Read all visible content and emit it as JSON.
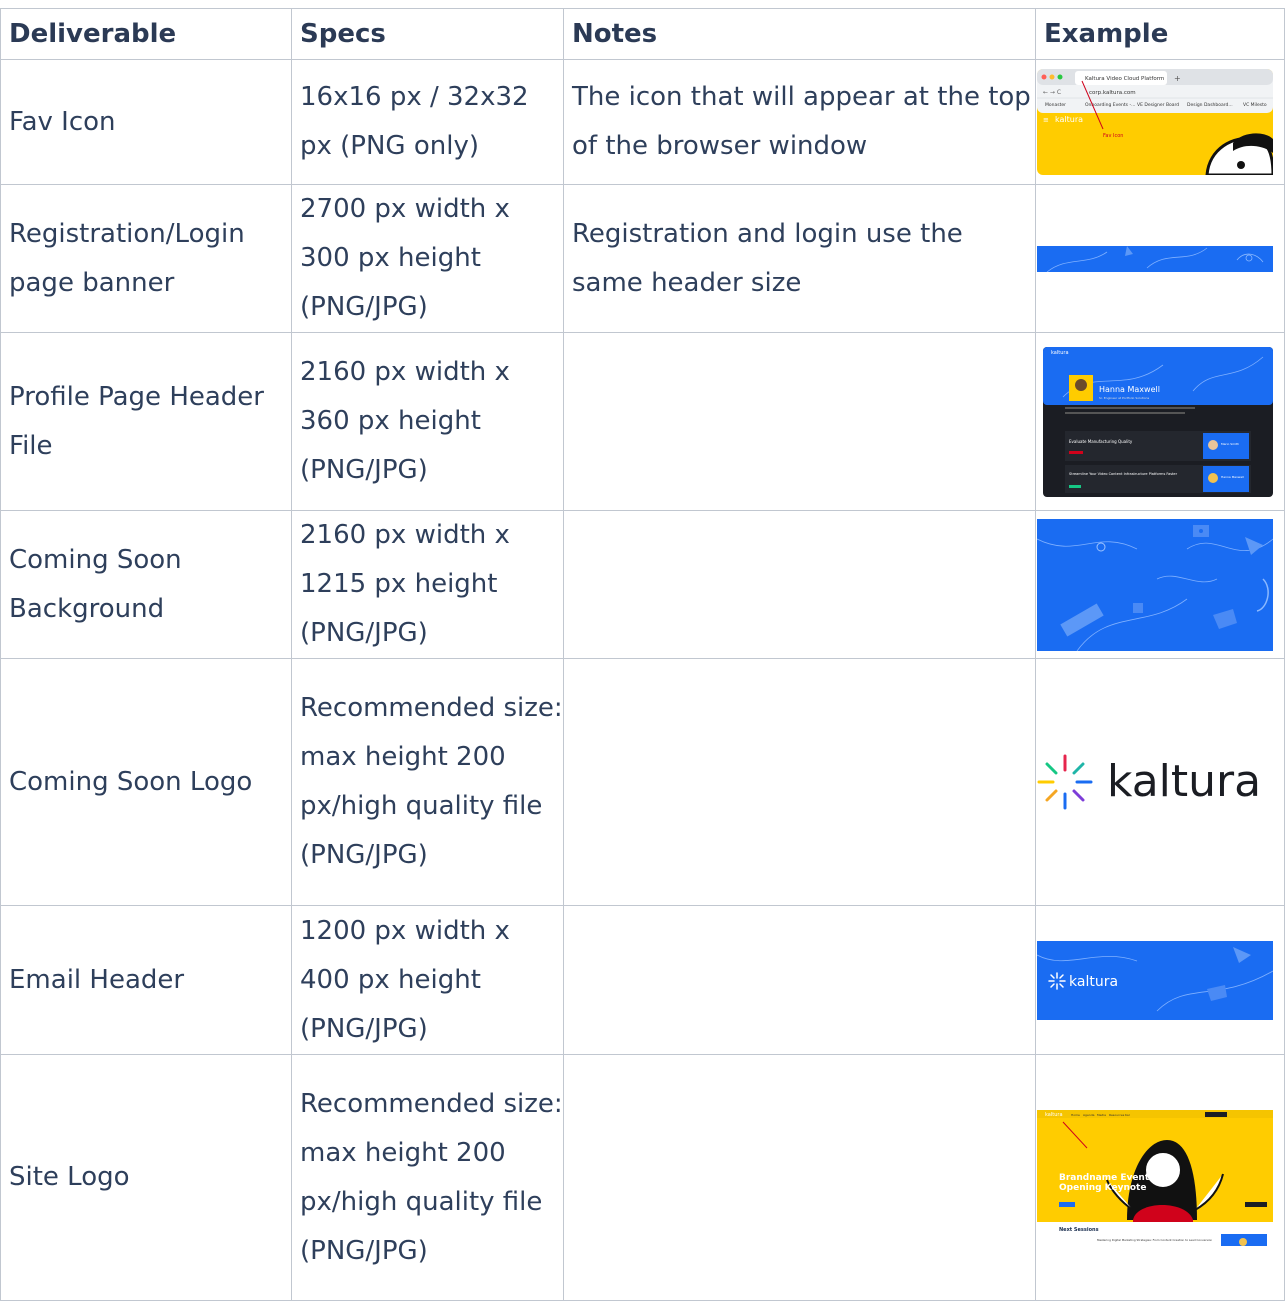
{
  "headers": [
    "Deliverable",
    "Specs",
    "Notes",
    "Example"
  ],
  "rows": [
    {
      "deliverable": "Fav Icon",
      "specs": "16x16 px / 32x32 px (PNG only)",
      "notes": "The icon that will appear at the top of the browser window",
      "example": "fav-icon-screenshot"
    },
    {
      "deliverable": "Registration/Login page banner",
      "specs": "2700 px width x 300 px height (PNG/JPG)",
      "notes": "Registration and login use the same header size",
      "example": "banner-strip"
    },
    {
      "deliverable": "Profile Page Header File",
      "specs": "2160 px width x 360 px height (PNG/JPG)",
      "notes": "",
      "example": "profile-page-screenshot"
    },
    {
      "deliverable": "Coming Soon Background",
      "specs": "2160 px width x 1215 px height (PNG/JPG)",
      "notes": "",
      "example": "blue-background"
    },
    {
      "deliverable": "Coming Soon Logo",
      "specs": "Recommended size: max height 200 px/high quality file (PNG/JPG)",
      "notes": "",
      "example": "kaltura-logo"
    },
    {
      "deliverable": "Email Header",
      "specs": "1200 px width x 400 px height (PNG/JPG)",
      "notes": "",
      "example": "email-header"
    },
    {
      "deliverable": "Site Logo",
      "specs": "Recommended size: max height 200 px/high quality file (PNG/JPG)",
      "notes": "",
      "example": "site-logo-screenshot"
    }
  ],
  "examples": {
    "fav_icon": {
      "tab_title": "Kaltura Video Cloud Platform",
      "url": "corp.kaltura.com",
      "bookmarks": [
        "Monaster",
        "Onboarding Events -...",
        "VE Designer Board",
        "Design Dashboard...",
        "VC Milesto"
      ],
      "brand": "kaltura",
      "annotation": "Fav Icon"
    },
    "profile": {
      "brand": "kaltura",
      "name": "Hanna Maxwell",
      "subtitle": "Sr. Engineer at Portfolio Solutions",
      "session1_title": "Evaluate Manufacturing Quality",
      "session2_title": "Streamline Your Video Content Infrastructure Platforms Faster",
      "speaker1": "Mario Smith",
      "speaker2": "Hanna Maxwell"
    },
    "logo": {
      "wordmark": "kaltura"
    },
    "email": {
      "wordmark": "kaltura"
    },
    "site": {
      "brand": "kaltura",
      "nav": [
        "Home",
        "Agenda",
        "Media",
        "Resources",
        "Kal"
      ],
      "headline_line1": "Brandname Eventname",
      "headline_line2": "Opening Keynote",
      "next_sessions": "Next Sessions",
      "session_title": "Mastering Digital Marketing Strategies: From Content Creation to Lead Conversion"
    }
  },
  "colors": {
    "accent_blue": "#1a6cf2",
    "yellow": "#ffcc00",
    "dark": "#1b1d23",
    "text": "#2e3f5b"
  }
}
